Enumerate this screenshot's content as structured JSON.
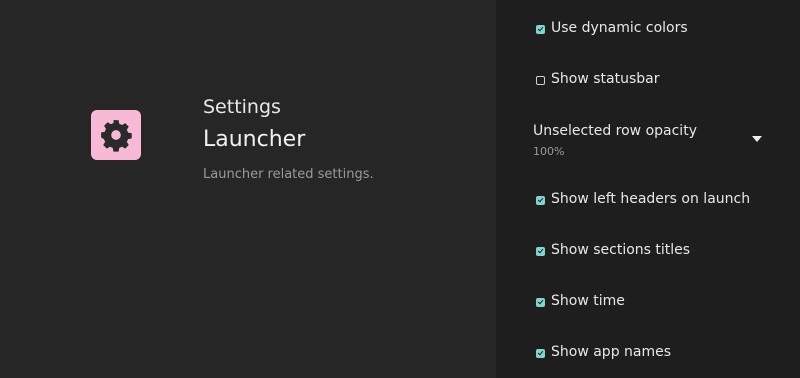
{
  "header": {
    "breadcrumb": "Settings",
    "title": "Launcher",
    "description": "Launcher related settings."
  },
  "icon": {
    "name": "gear-icon",
    "background": "#f7b9d6",
    "foreground": "#2a2a2a"
  },
  "settings": {
    "use_dynamic_colors": {
      "label": "Use dynamic colors",
      "checked": true
    },
    "show_statusbar": {
      "label": "Show statusbar",
      "checked": false
    },
    "unselected_row_opacity": {
      "label": "Unselected row opacity",
      "value": "100%"
    },
    "show_left_headers": {
      "label": "Show left headers on launch",
      "checked": true
    },
    "show_sections_titles": {
      "label": "Show sections titles",
      "checked": true
    },
    "show_time": {
      "label": "Show time",
      "checked": true
    },
    "show_app_names": {
      "label": "Show app names",
      "checked": true
    }
  },
  "colors": {
    "accent": "#7fd6cf",
    "left_background": "#262626",
    "right_background": "#1e1e1e"
  }
}
